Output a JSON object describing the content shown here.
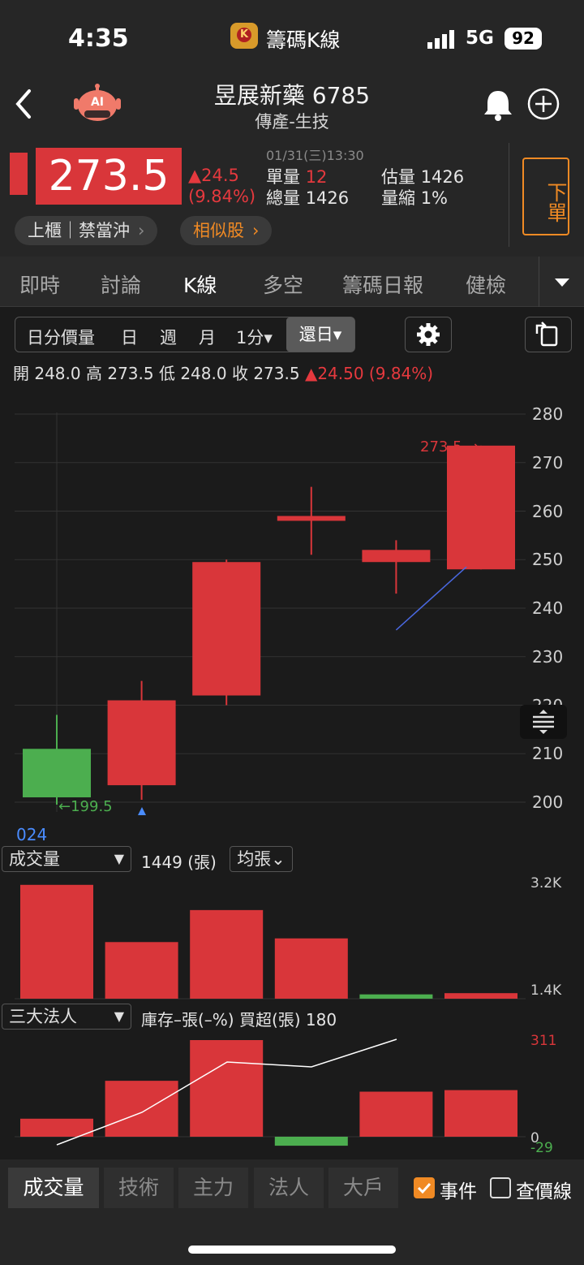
{
  "status": {
    "time": "4:35",
    "app": "籌碼K線",
    "network": "5G",
    "battery": "92"
  },
  "header": {
    "stock_name": "昱展新藥 6785",
    "sector": "傳產-生技",
    "price": "273.5",
    "change": "▲24.5",
    "change_pct": "(9.84%)",
    "datetime": "01/31(三)13:30",
    "single_vol_label": "單量",
    "single_vol": "12",
    "total_vol_label": "總量",
    "total_vol": "1426",
    "est_vol_label": "估量",
    "est_vol": "1426",
    "shrink_label": "量縮",
    "shrink": "1%",
    "order_btn": "下單",
    "tag_market": "上櫃｜禁當沖",
    "tag_similar": "相似股"
  },
  "tabs": [
    "即時",
    "討論",
    "K線",
    "多空",
    "籌碼日報",
    "健檢"
  ],
  "toolbar": {
    "items": [
      "日分價量",
      "日",
      "週",
      "月",
      "1分▾",
      "還日▾"
    ]
  },
  "ohlc": {
    "open_label": "開",
    "open": "248.0",
    "high_label": "高",
    "high": "273.5",
    "low_label": "低",
    "low": "248.0",
    "close_label": "收",
    "close": "273.5",
    "change": "▲24.50 (9.84%)"
  },
  "price_axis": [
    "280",
    "270",
    "260",
    "250",
    "240",
    "230",
    "220",
    "210",
    "200"
  ],
  "annotations": {
    "min": "←199.5",
    "max": "273.5 →",
    "year": "024"
  },
  "colors": {
    "up": "#d9363a",
    "down": "#4cae4f",
    "bg": "#1b1b1b",
    "accent": "#f08a24"
  },
  "chart_data": [
    {
      "type": "candlestick",
      "x": [
        "1",
        "2",
        "3",
        "4",
        "5",
        "6"
      ],
      "open": [
        211,
        203.5,
        222,
        258,
        249.5,
        248
      ],
      "high": [
        218,
        225,
        250,
        265,
        254,
        273.5
      ],
      "low": [
        199.5,
        200.5,
        220,
        251,
        243,
        248
      ],
      "close": [
        201,
        221,
        249.5,
        259,
        252,
        273.5
      ],
      "ylim": [
        200,
        280
      ]
    },
    {
      "type": "bar",
      "label": "成交量",
      "value_text": "1449 (張)",
      "avg_label": "均張⌄",
      "values": [
        3150,
        2220,
        2740,
        2280,
        1370,
        1390
      ],
      "colors": [
        "up",
        "up",
        "up",
        "up",
        "down",
        "up"
      ],
      "yticks": [
        "3.2K",
        "1.4K"
      ]
    },
    {
      "type": "bar",
      "label": "三大法人",
      "subtitle": "庫存–張(–%)  買超(張) 180",
      "values": [
        58,
        180,
        311,
        -29,
        145,
        150
      ],
      "colors": [
        "up",
        "up",
        "up",
        "down",
        "up",
        "up"
      ],
      "yticks": [
        "311",
        "0",
        "-29"
      ]
    }
  ],
  "bottom": {
    "tabs": [
      "成交量",
      "技術",
      "主力",
      "法人",
      "大戶"
    ],
    "event": "事件",
    "price_line": "查價線"
  }
}
